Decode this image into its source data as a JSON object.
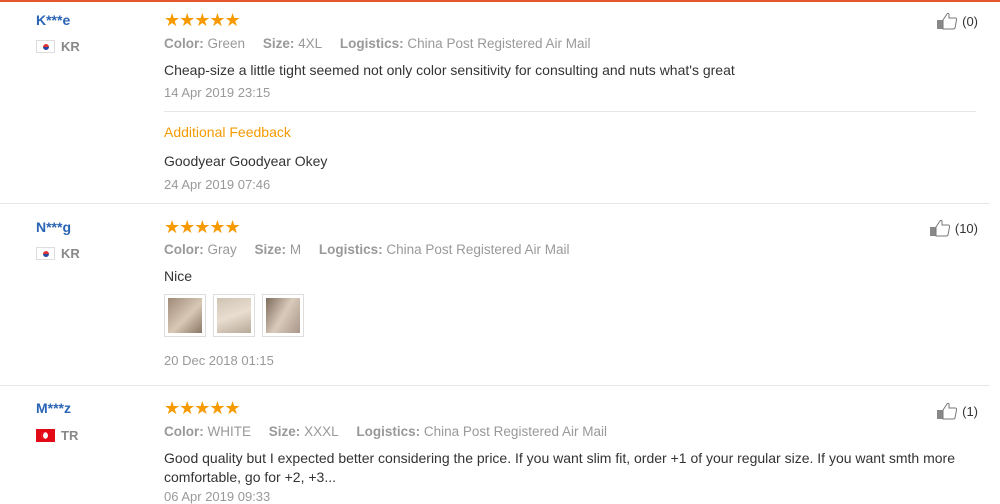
{
  "reviews": [
    {
      "user": "K***e",
      "country": "KR",
      "rating_stars": "★★★★★",
      "rating": 5,
      "meta": {
        "color_label": "Color:",
        "color": "Green",
        "size_label": "Size:",
        "size": "4XL",
        "logistics_label": "Logistics:",
        "logistics": "China Post Registered Air Mail"
      },
      "text": "Cheap-size a little tight seemed not only color sensitivity for consulting and nuts what's great",
      "date": "14 Apr 2019 23:15",
      "likes": "(0)",
      "additional_feedback_label": "Additional Feedback",
      "additional_text": "Goodyear Goodyear Okey",
      "additional_date": "24 Apr 2019 07:46"
    },
    {
      "user": "N***g",
      "country": "KR",
      "rating_stars": "★★★★★",
      "rating": 5,
      "meta": {
        "color_label": "Color:",
        "color": "Gray",
        "size_label": "Size:",
        "size": "M",
        "logistics_label": "Logistics:",
        "logistics": "China Post Registered Air Mail"
      },
      "text": "Nice",
      "date": "20 Dec 2018 01:15",
      "likes": "(10)"
    },
    {
      "user": "M***z",
      "country": "TR",
      "rating_stars": "★★★★★",
      "rating": 5,
      "meta": {
        "color_label": "Color:",
        "color": "WHITE",
        "size_label": "Size:",
        "size": "XXXL",
        "logistics_label": "Logistics:",
        "logistics": "China Post Registered Air Mail"
      },
      "text": "Good quality but I expected better considering the price. If you want slim fit, order +1 of your regular size. If you want smth more comfortable, go for +2, +3...",
      "date": "06 Apr 2019 09:33",
      "likes": "(1)"
    }
  ],
  "colors": {
    "accent": "#f79a00",
    "username": "#2a64b4",
    "top_border": "#e4572e"
  }
}
